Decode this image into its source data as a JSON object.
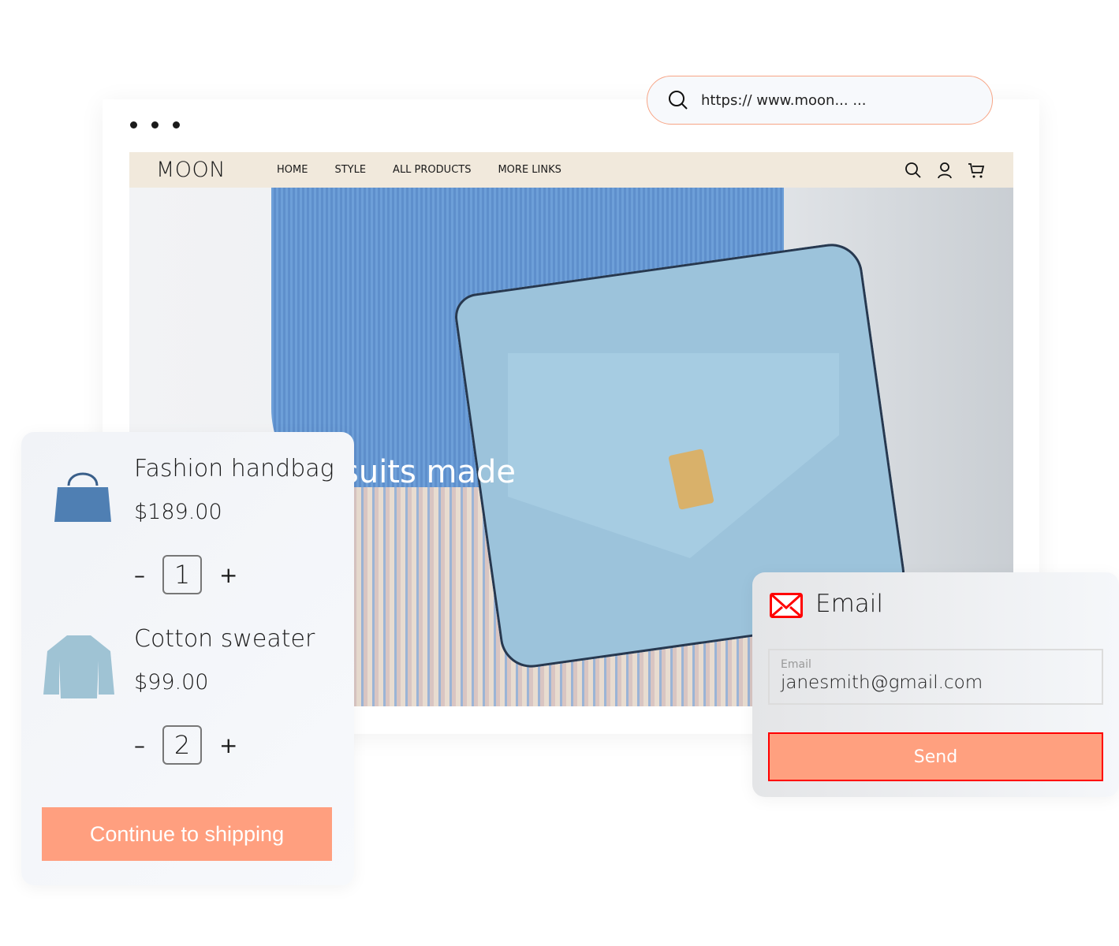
{
  "browser": {
    "url": "https:// www.moon... ..."
  },
  "site": {
    "logo": "MOON",
    "nav": [
      "HOME",
      "STYLE",
      "ALL PRODUCTS",
      "MORE LINKS"
    ],
    "hero_text": "suits made"
  },
  "cart": {
    "items": [
      {
        "name": "Fashion handbag",
        "price": "$189.00",
        "qty": "1"
      },
      {
        "name": "Cotton sweater",
        "price": "$99.00",
        "qty": "2"
      }
    ],
    "minus": "–",
    "plus": "+",
    "continue_label": "Continue to shipping"
  },
  "email": {
    "title": "Email",
    "field_label": "Email",
    "field_value": "janesmith@gmail.com",
    "send_label": "Send"
  },
  "colors": {
    "accent": "#ffa07f",
    "nav_bg": "#f1e9dc",
    "email_icon": "#ff0000"
  }
}
